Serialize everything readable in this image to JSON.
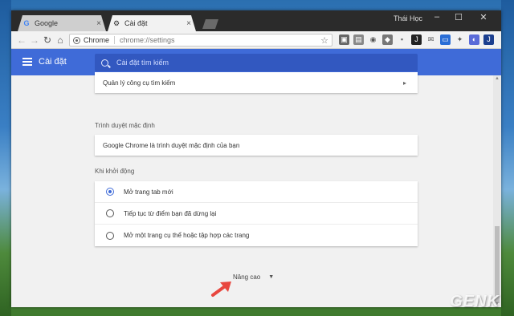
{
  "tabs": [
    {
      "label": "Google",
      "icon": "google-g-icon",
      "active": false
    },
    {
      "label": "Cài đặt",
      "icon": "gear-icon",
      "active": true
    }
  ],
  "window": {
    "user": "Thái Học"
  },
  "toolbar": {
    "chip": "Chrome",
    "url": "chrome://settings"
  },
  "settings": {
    "title": "Cài đặt",
    "search_placeholder": "Cài đặt tìm kiếm"
  },
  "sections": {
    "search_engine_manage": "Quản lý công cụ tìm kiếm",
    "default_browser_title": "Trình duyệt mặc định",
    "default_browser_text": "Google Chrome là trình duyệt mặc định của bạn",
    "startup_title": "Khi khởi động",
    "startup_options": [
      {
        "label": "Mở trang tab mới",
        "checked": true
      },
      {
        "label": "Tiếp tục từ điểm bạn đã dừng lại",
        "checked": false
      },
      {
        "label": "Mở một trang cụ thể hoặc tập hợp các trang",
        "checked": false
      }
    ],
    "advanced": "Nâng cao"
  },
  "watermark": "GENK",
  "colors": {
    "accent": "#3f6bd8",
    "header": "#3f6bd8",
    "arrow": "#e8473f"
  }
}
